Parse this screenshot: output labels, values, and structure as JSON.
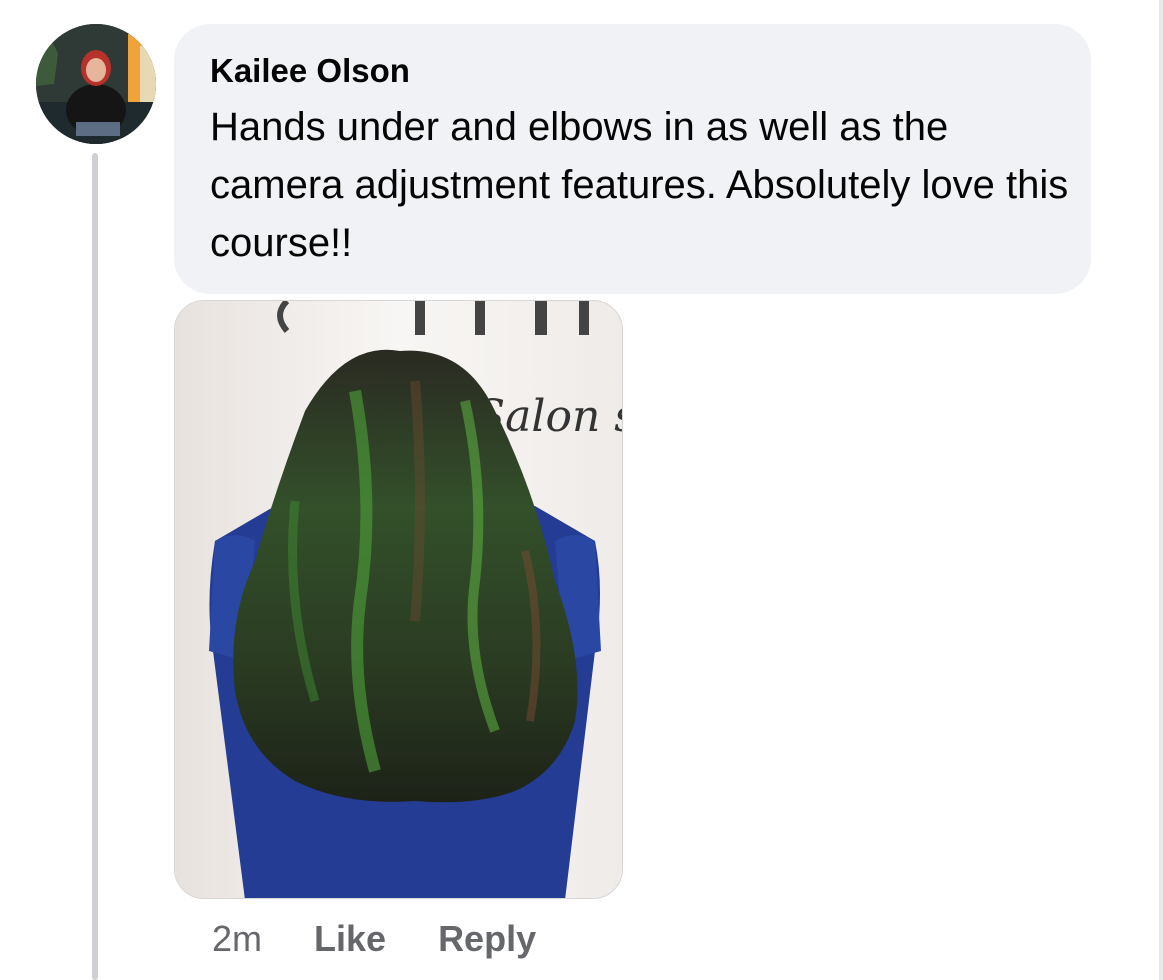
{
  "comment": {
    "author": "Kailee Olson",
    "text": "Hands under and elbows in as well as the camera adjustment features. Absolutely love this course!!",
    "timestamp": "2m",
    "like_label": "Like",
    "reply_label": "Reply"
  },
  "photo": {
    "icon": "attached-hair-photo",
    "background_lettering": "Salon st"
  },
  "colors": {
    "bubble_background": "#f0f2f5",
    "text_primary": "#050505",
    "text_secondary": "#65676b",
    "thread_line": "#ced0d4"
  }
}
